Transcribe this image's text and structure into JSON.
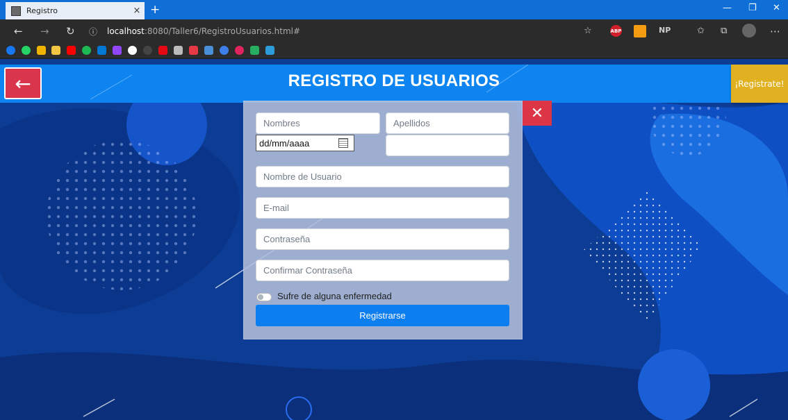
{
  "browser": {
    "tab_title": "Registro",
    "tab_close": "×",
    "new_tab": "+",
    "url_host": "localhost",
    "url_path": ":8080/Taller6/RegistroUsuarios.html#",
    "ext_abp": "ABP",
    "ext_np": "NP",
    "icons": [
      "back-arrow-icon",
      "forward-arrow-icon",
      "refresh-icon",
      "info-icon",
      "star-icon",
      "favorites-icon",
      "collections-icon",
      "profile-icon",
      "more-icon"
    ]
  },
  "header": {
    "title": "REGISTRO DE USUARIOS",
    "signup_label": "¡Registrate!",
    "back_symbol": "←"
  },
  "form": {
    "close_symbol": "✕",
    "fields": {
      "nombres": "Nombres",
      "apellidos": "Apellidos",
      "fecha": "dd/mm/aaaa",
      "usuario": "Nombre de Usuario",
      "email": "E-mail",
      "password": "Contraseña",
      "confirm": "Confirmar Contraseña"
    },
    "toggle_label": "Sufre de alguna enfermedad",
    "toggle_on": false,
    "submit_label": "Registrarse"
  },
  "colors": {
    "header": "#0d84f0",
    "back_button": "#d9364b",
    "signup_button": "#e1b121",
    "submit_button": "#0d7ef0",
    "close_button": "#dc3545",
    "page_background": "#0c3c94"
  }
}
